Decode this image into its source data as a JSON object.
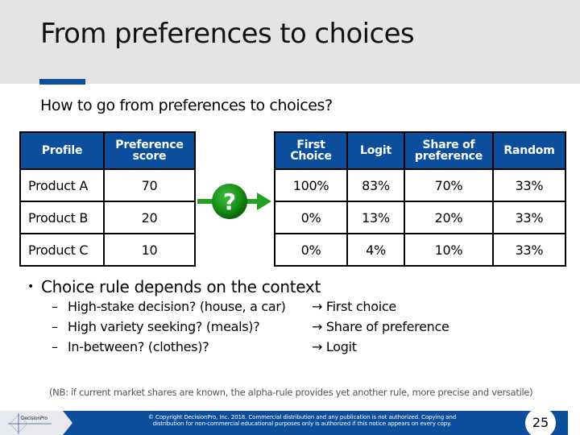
{
  "slide": {
    "title": "From preferences to choices",
    "subtitle": "How to go from preferences to choices?",
    "accent_color": "#0b4f9c",
    "header_band_color": "#e4e4e4",
    "page_number": "25"
  },
  "left_table": {
    "headers": [
      "Profile",
      [
        "Preference",
        "score"
      ]
    ],
    "rows": [
      {
        "profile": "Product A",
        "score": "70"
      },
      {
        "profile": "Product B",
        "score": "20"
      },
      {
        "profile": "Product C",
        "score": "10"
      }
    ]
  },
  "flow_icon": {
    "name": "question-arrow-icon",
    "glyph": "?",
    "color": "#1a8a1a"
  },
  "right_table": {
    "headers": [
      [
        "First",
        "Choice"
      ],
      [
        "Logit"
      ],
      [
        "Share of",
        "preference"
      ],
      [
        "Random"
      ]
    ],
    "rows": [
      [
        "100%",
        "83%",
        "70%",
        "33%"
      ],
      [
        "0%",
        "13%",
        "20%",
        "33%"
      ],
      [
        "0%",
        "4%",
        "10%",
        "33%"
      ]
    ]
  },
  "bullets": {
    "main": "Choice rule depends on the context",
    "bullet_glyph": "•",
    "sub_glyph": "–",
    "arrow_glyph": "→",
    "items": [
      {
        "question": "High-stake decision? (house, a car)",
        "rule": "First choice"
      },
      {
        "question": "High variety seeking? (meals)?",
        "rule": "Share of preference"
      },
      {
        "question": "In-between? (clothes)?",
        "rule": "Logit"
      }
    ]
  },
  "note": "(NB: if current market shares are known, the alpha-rule provides yet another rule, more precise and versatile)",
  "footer": {
    "logo_text": "DecisionPro",
    "copyright_line1": "© Copyright DecisionPro, Inc. 2018. Commercial distribution and any publication is not authorized. Copying and",
    "copyright_line2": "distribution for non-commercial educational purposes only is authorized if this notice appears on every copy."
  }
}
